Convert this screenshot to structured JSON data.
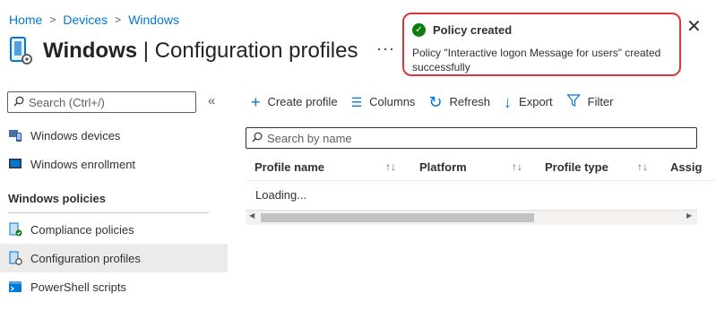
{
  "breadcrumb": [
    "Home",
    "Devices",
    "Windows"
  ],
  "page": {
    "title_bold": "Windows",
    "title_rest": " | Configuration profiles",
    "more": "···"
  },
  "sidebar": {
    "search_placeholder": "Search (Ctrl+/)",
    "collapse_glyph": "«",
    "items_top": [
      {
        "label": "Windows devices",
        "icon": "devices-icon"
      },
      {
        "label": "Windows enrollment",
        "icon": "enrollment-icon"
      }
    ],
    "section_header": "Windows policies",
    "items_policies": [
      {
        "label": "Compliance policies",
        "icon": "compliance-icon"
      },
      {
        "label": "Configuration profiles",
        "icon": "configuration-icon",
        "selected": true
      },
      {
        "label": "PowerShell scripts",
        "icon": "powershell-icon"
      }
    ]
  },
  "toolbar": {
    "create": "Create profile",
    "columns": "Columns",
    "refresh": "Refresh",
    "export": "Export",
    "filter": "Filter"
  },
  "grid": {
    "search_placeholder": "Search by name",
    "columns": [
      "Profile name",
      "Platform",
      "Profile type",
      "Assig"
    ],
    "sort_glyph": "↑↓",
    "status": "Loading..."
  },
  "toast": {
    "title": "Policy created",
    "message": "Policy \"Interactive logon Message for users\" created successfully"
  },
  "colors": {
    "accent": "#0078d4",
    "success": "#107c10",
    "highlight_border": "#d9363e"
  }
}
